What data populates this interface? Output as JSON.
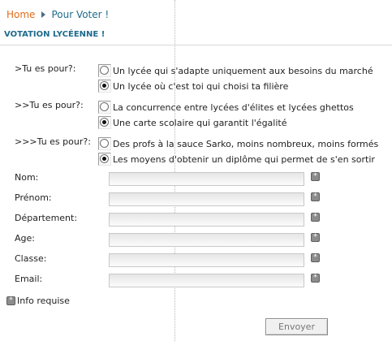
{
  "breadcrumb": {
    "home": "Home",
    "current": "Pour Voter !"
  },
  "page_title": "VOTATION LYCÉENNE !",
  "questions": [
    {
      "label": ">Tu es pour?:",
      "options": [
        {
          "label": "Un lycée qui s'adapte uniquement aux besoins du marché",
          "checked": false
        },
        {
          "label": "Un lycée où c'est toi qui choisi ta filière",
          "checked": true
        }
      ]
    },
    {
      "label": ">>Tu es pour?:",
      "options": [
        {
          "label": "La concurrence entre lycées d'élites et lycées ghettos",
          "checked": false
        },
        {
          "label": "Une carte scolaire qui garantit l'égalité",
          "checked": true
        }
      ]
    },
    {
      "label": ">>>Tu es pour?:",
      "options": [
        {
          "label": "Des profs à la sauce Sarko, moins nombreux, moins formés",
          "checked": false
        },
        {
          "label": "Les moyens d'obtenir un diplôme qui permet de s'en sortir",
          "checked": true
        }
      ]
    }
  ],
  "fields": [
    {
      "label": "Nom:",
      "value": ""
    },
    {
      "label": "Prénom:",
      "value": ""
    },
    {
      "label": "Département:",
      "value": ""
    },
    {
      "label": "Age:",
      "value": ""
    },
    {
      "label": "Classe:",
      "value": ""
    },
    {
      "label": "Email:",
      "value": ""
    }
  ],
  "required_icon": "asterisk-icon",
  "required_legend": "Info requise",
  "submit_label": "Envoyer",
  "colors": {
    "breadcrumb_home": "#e06b1a",
    "accent": "#1f6b8c"
  }
}
